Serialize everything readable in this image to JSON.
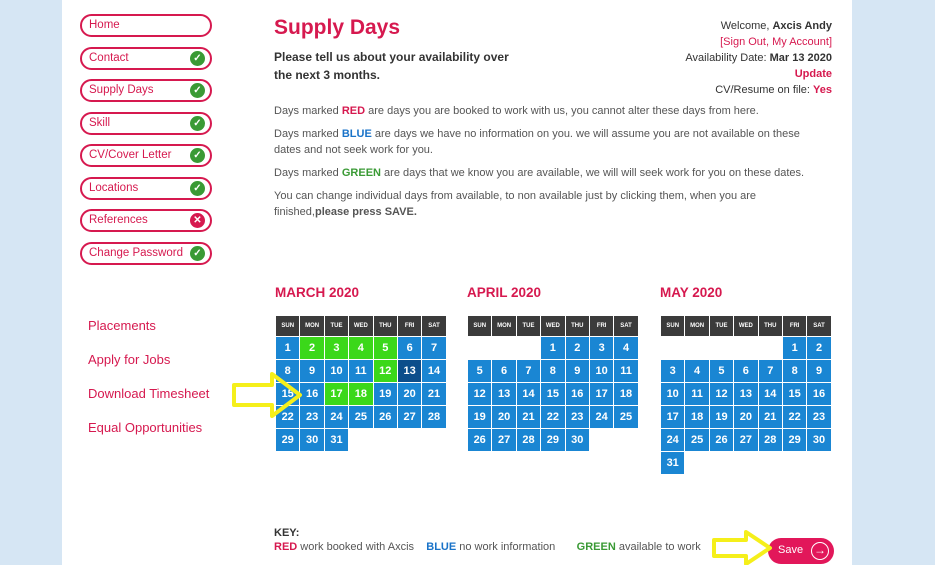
{
  "nav": [
    {
      "label": "Home",
      "status": ""
    },
    {
      "label": "Contact",
      "status": "ok"
    },
    {
      "label": "Supply Days",
      "status": "ok"
    },
    {
      "label": "Skill",
      "status": "ok"
    },
    {
      "label": "CV/Cover Letter",
      "status": "ok"
    },
    {
      "label": "Locations",
      "status": "ok"
    },
    {
      "label": "References",
      "status": "bad"
    },
    {
      "label": "Change Password",
      "status": "ok"
    }
  ],
  "links": [
    "Placements",
    "Apply for Jobs",
    "Download Timesheet",
    "Equal Opportunities"
  ],
  "header": {
    "title": "Supply Days",
    "subtitle": "Please tell us about your availability over the next 3 months."
  },
  "account": {
    "welcome": "Welcome,",
    "name": "Axcis Andy",
    "sign_out": "[Sign Out, My Account]",
    "availability_label": "Availability Date:",
    "availability_date": "Mar 13 2020",
    "update": "Update",
    "cv_label": "CV/Resume on file:",
    "cv_value": "Yes"
  },
  "info": {
    "p1_pre": "Days marked ",
    "p1_key": "RED",
    "p1_post": " are days you are booked to work with us, you cannot alter these days from here.",
    "p2_pre": "Days marked ",
    "p2_key": "BLUE",
    "p2_post": " are days we have no information on you. we will assume you are not available on these dates and not seek work for you.",
    "p3_pre": "Days marked ",
    "p3_key": "GREEN",
    "p3_post": " are days that we know you are available, we will will seek work for you on these dates.",
    "p4_pre": "You can change individual days from available, to non available just by clicking them, when you are finished,",
    "p4_bold": "please press SAVE."
  },
  "weekdays": [
    "SUN",
    "MON",
    "TUE",
    "WED",
    "THU",
    "FRI",
    "SAT"
  ],
  "months": [
    {
      "title": "MARCH 2020",
      "start": 0,
      "days": 31,
      "green": [
        2,
        3,
        4,
        5,
        12,
        17,
        18
      ],
      "dark": [
        13
      ]
    },
    {
      "title": "APRIL 2020",
      "start": 3,
      "days": 30,
      "green": [],
      "dark": []
    },
    {
      "title": "MAY 2020",
      "start": 5,
      "days": 31,
      "green": [],
      "dark": []
    }
  ],
  "key": {
    "label": "KEY:",
    "red": "RED",
    "red_text": " work booked with Axcis",
    "blue": "BLUE",
    "blue_text": " no work information",
    "green": "GREEN",
    "green_text": " available to work"
  },
  "save_label": "Save",
  "colors": {
    "accent": "#d6194f",
    "blue": "#1a86d3",
    "green": "#3bd81a",
    "selected": "#0c4e8b",
    "arrow": "#f5ef1a"
  }
}
